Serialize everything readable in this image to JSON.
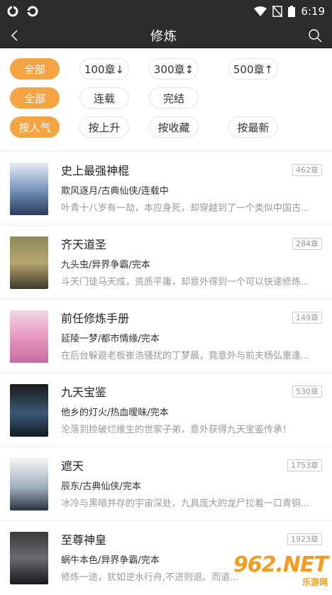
{
  "status": {
    "time": "6:19",
    "left_icons": [
      "sync-icon",
      "sync-icon"
    ],
    "right_icons": [
      "wifi-icon",
      "no-sim-icon",
      "battery-icon"
    ]
  },
  "nav": {
    "title": "修炼",
    "back_icon": "back-chevron-icon",
    "search_icon": "search-icon"
  },
  "filters": {
    "row1": [
      "全部",
      "100章↓",
      "300章↕",
      "500章↑"
    ],
    "row2": [
      "全部",
      "连载",
      "完结"
    ],
    "row3": [
      "按人气",
      "按上升",
      "按收藏",
      "按最新"
    ]
  },
  "books": [
    {
      "title": "史上最强神棍",
      "chapters": "462章",
      "meta": "欺风逐月/古典仙侠/连载中",
      "desc": "叶青十八岁有一劫，本应身死，却穿越到了一个类似中国古..."
    },
    {
      "title": "齐天道圣",
      "chapters": "284章",
      "meta": "九头虫/异界争霸/完本",
      "desc": "斗天门徒马天成，资质平庸，却意外得到一个可以快速修炼..."
    },
    {
      "title": "前任修炼手册",
      "chapters": "149章",
      "meta": "延陵一梦/都市情缘/完本",
      "desc": "在后台躲避老板崔浩骚扰的丁梦晨，竟意外与前夫杨弘重逢..."
    },
    {
      "title": "九天宝鉴",
      "chapters": "530章",
      "meta": "他乡的灯火/热血暧昧/完本",
      "desc": "沦落到捡破烂维生的世家子弟，意外获得九天宝鉴传承！"
    },
    {
      "title": "遮天",
      "chapters": "1753章",
      "meta": "辰东/古典仙侠/完本",
      "desc": "冰冷与黑暗并存的宇宙深处，九具庞大的龙尸拉着一口青铜..."
    },
    {
      "title": "至尊神皇",
      "chapters": "1923章",
      "meta": "蜗牛本色/异界争霸/完本",
      "desc": "修炼一途，犹如逆水行舟,不进则退。而道..."
    }
  ],
  "watermark": {
    "num": "962.NET",
    "txt": "乐游网"
  },
  "colors": {
    "accent": "#f5a443",
    "bar": "#2b2b2b"
  }
}
